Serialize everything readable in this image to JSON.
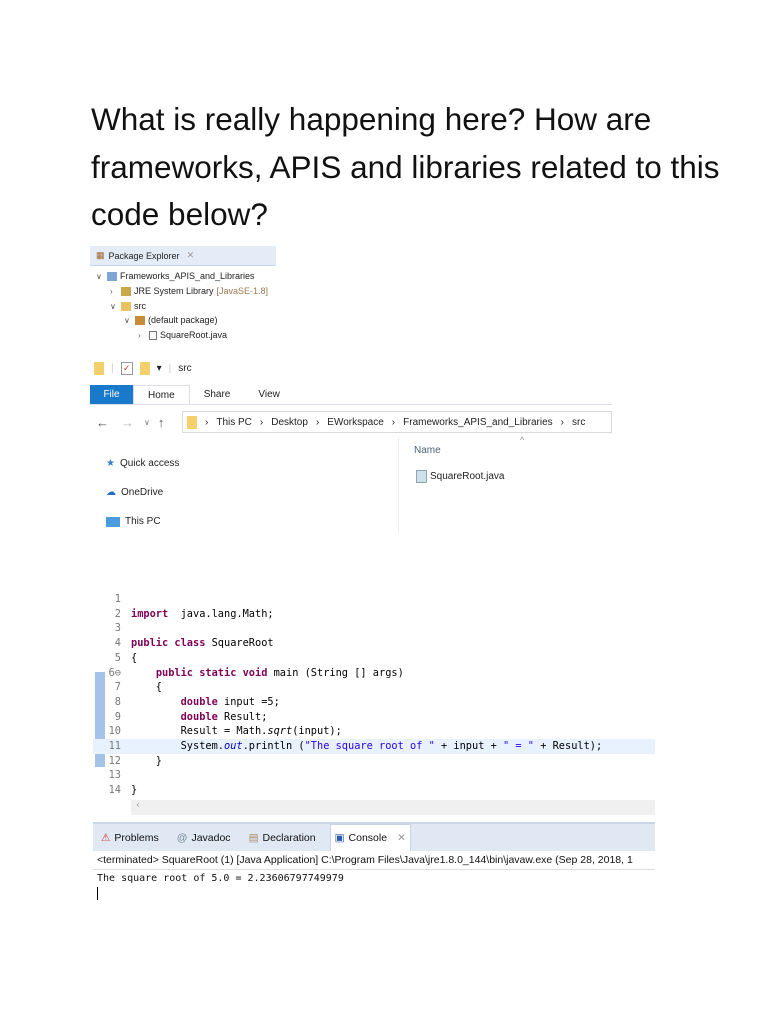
{
  "question": "What is really happening here? How are frameworks, APIS and libraries related to this code below?",
  "package_explorer": {
    "title": "Package Explorer",
    "close": "✕",
    "project": "Frameworks_APIS_and_Libraries",
    "jre": "JRE System Library",
    "jre_version": "[JavaSE-1.8]",
    "src": "src",
    "package": "(default package)",
    "file": "SquareRoot.java"
  },
  "explorer": {
    "qat_title": "src",
    "tabs": [
      "File",
      "Home",
      "Share",
      "View"
    ],
    "breadcrumb": [
      "This PC",
      "Desktop",
      "EWorkspace",
      "Frameworks_APIS_and_Libraries",
      "src"
    ],
    "nav_items": [
      "Quick access",
      "OneDrive",
      "This PC"
    ],
    "column": "Name",
    "file": "SquareRoot.java"
  },
  "code": [
    {
      "n": "1",
      "t": []
    },
    {
      "n": "2",
      "t": [
        [
          "kw",
          "import"
        ],
        [
          "",
          "  java.lang.Math;"
        ]
      ]
    },
    {
      "n": "3",
      "t": []
    },
    {
      "n": "4",
      "t": [
        [
          "kw",
          "public class"
        ],
        [
          "",
          " SquareRoot"
        ]
      ]
    },
    {
      "n": "5",
      "t": [
        [
          "",
          "{"
        ]
      ]
    },
    {
      "n": "6⊖",
      "t": [
        [
          "",
          "    "
        ],
        [
          "kw",
          "public static void"
        ],
        [
          "",
          " main (String [] args)"
        ]
      ]
    },
    {
      "n": "7",
      "t": [
        [
          "",
          "    {"
        ]
      ]
    },
    {
      "n": "8",
      "t": [
        [
          "",
          "        "
        ],
        [
          "kw",
          "double"
        ],
        [
          "",
          " input =5;"
        ]
      ]
    },
    {
      "n": "9",
      "t": [
        [
          "",
          "        "
        ],
        [
          "kw",
          "double"
        ],
        [
          "",
          " Result;"
        ]
      ]
    },
    {
      "n": "10",
      "t": [
        [
          "",
          "        Result = Math."
        ],
        [
          "it",
          "sqrt"
        ],
        [
          "",
          "(input);"
        ]
      ]
    },
    {
      "n": "11",
      "t": [
        [
          "",
          "        System."
        ],
        [
          "fld",
          "out"
        ],
        [
          "",
          ".println ("
        ],
        [
          "str",
          "\"The square root of \""
        ],
        [
          "",
          " + input + "
        ],
        [
          "str",
          "\" = \""
        ],
        [
          "",
          " + Result);"
        ]
      ]
    },
    {
      "n": "12",
      "t": [
        [
          "",
          "    }"
        ]
      ]
    },
    {
      "n": "13",
      "t": []
    },
    {
      "n": "14",
      "t": [
        [
          "",
          "}"
        ]
      ]
    }
  ],
  "console": {
    "tabs": [
      "Problems",
      "Javadoc",
      "Declaration",
      "Console"
    ],
    "terminated": "<terminated> SquareRoot (1) [Java Application] C:\\Program Files\\Java\\jre1.8.0_144\\bin\\javaw.exe (Sep 28, 2018, 1",
    "output": "The square root of 5.0 = 2.23606797749979"
  }
}
